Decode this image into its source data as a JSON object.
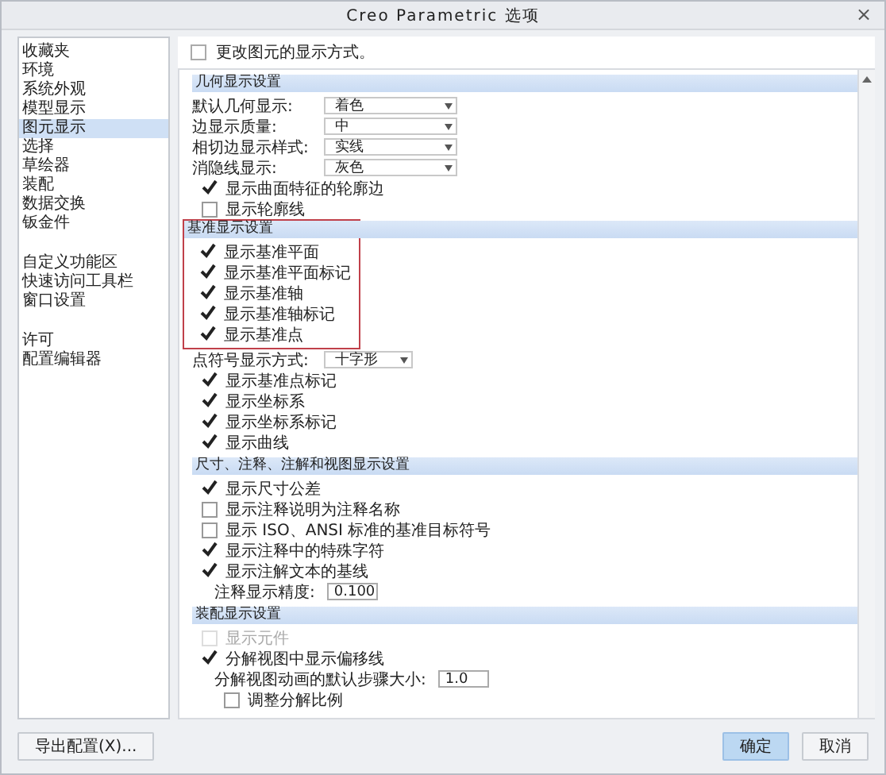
{
  "window": {
    "title": "Creo Parametric 选项",
    "close": "×"
  },
  "sidebar": {
    "groups": [
      {
        "items": [
          {
            "label": "收藏夹",
            "selected": false
          },
          {
            "label": "环境",
            "selected": false
          },
          {
            "label": "系统外观",
            "selected": false
          },
          {
            "label": "模型显示",
            "selected": false
          },
          {
            "label": "图元显示",
            "selected": true
          },
          {
            "label": "选择",
            "selected": false
          },
          {
            "label": "草绘器",
            "selected": false
          },
          {
            "label": "装配",
            "selected": false
          },
          {
            "label": "数据交换",
            "selected": false
          },
          {
            "label": "钣金件",
            "selected": false
          }
        ]
      },
      {
        "items": [
          {
            "label": "自定义功能区",
            "selected": false
          },
          {
            "label": "快速访问工具栏",
            "selected": false
          },
          {
            "label": "窗口设置",
            "selected": false
          }
        ]
      },
      {
        "items": [
          {
            "label": "许可",
            "selected": false
          },
          {
            "label": "配置编辑器",
            "selected": false
          }
        ]
      }
    ]
  },
  "intro": "更改图元的显示方式。",
  "sections": [
    {
      "title": "几何显示设置",
      "highlighted": false,
      "rows": [
        {
          "kind": "select",
          "label": "默认几何显示:",
          "value": "着色"
        },
        {
          "kind": "select",
          "label": "边显示质量:",
          "value": "中"
        },
        {
          "kind": "select",
          "label": "相切边显示样式:",
          "value": "实线"
        },
        {
          "kind": "select",
          "label": "消隐线显示:",
          "value": "灰色"
        },
        {
          "kind": "check",
          "label": "显示曲面特征的轮廓边",
          "checked": true,
          "disabled": false
        },
        {
          "kind": "check",
          "label": "显示轮廓线",
          "checked": false,
          "disabled": false
        }
      ]
    },
    {
      "title": "基准显示设置",
      "highlighted": true,
      "rows": [
        {
          "kind": "check",
          "label": "显示基准平面",
          "checked": true,
          "disabled": false
        },
        {
          "kind": "check",
          "label": "显示基准平面标记",
          "checked": true,
          "disabled": false
        },
        {
          "kind": "check",
          "label": "显示基准轴",
          "checked": true,
          "disabled": false
        },
        {
          "kind": "check",
          "label": "显示基准轴标记",
          "checked": true,
          "disabled": false
        },
        {
          "kind": "check",
          "label": "显示基准点",
          "checked": true,
          "disabled": false
        }
      ],
      "more_rows": [
        {
          "kind": "select",
          "label": "点符号显示方式:",
          "value": "十字形"
        },
        {
          "kind": "check",
          "label": "显示基准点标记",
          "checked": true,
          "disabled": false
        },
        {
          "kind": "check",
          "label": "显示坐标系",
          "checked": true,
          "disabled": false
        },
        {
          "kind": "check",
          "label": "显示坐标系标记",
          "checked": true,
          "disabled": false
        },
        {
          "kind": "check",
          "label": "显示曲线",
          "checked": true,
          "disabled": false
        }
      ]
    },
    {
      "title": "尺寸、注释、注解和视图显示设置",
      "highlighted": false,
      "rows": [
        {
          "kind": "check",
          "label": "显示尺寸公差",
          "checked": true,
          "disabled": false
        },
        {
          "kind": "check",
          "label": "显示注释说明为注释名称",
          "checked": false,
          "disabled": false
        },
        {
          "kind": "check",
          "label": "显示 ISO、ANSI 标准的基准目标符号",
          "checked": false,
          "disabled": false
        },
        {
          "kind": "check",
          "label": "显示注释中的特殊字符",
          "checked": true,
          "disabled": false
        },
        {
          "kind": "check",
          "label": "显示注解文本的基线",
          "checked": true,
          "disabled": false,
          "children": [
            {
              "kind": "number",
              "label": "注释显示精度:",
              "value": "0.100"
            }
          ]
        }
      ]
    },
    {
      "title": "装配显示设置",
      "highlighted": false,
      "rows": [
        {
          "kind": "check",
          "label": "显示元件",
          "checked": false,
          "disabled": true
        },
        {
          "kind": "check",
          "label": "分解视图中显示偏移线",
          "checked": true,
          "disabled": false,
          "children": [
            {
              "kind": "number",
              "label": "分解视图动画的默认步骤大小:",
              "value": "1.0"
            },
            {
              "kind": "check",
              "label": "调整分解比例",
              "checked": false,
              "disabled": false
            }
          ]
        }
      ]
    }
  ],
  "buttons": [
    {
      "label": "导出配置(X)...",
      "primary": false
    },
    {
      "label": "确定",
      "primary": true
    },
    {
      "label": "取消",
      "primary": false
    }
  ]
}
